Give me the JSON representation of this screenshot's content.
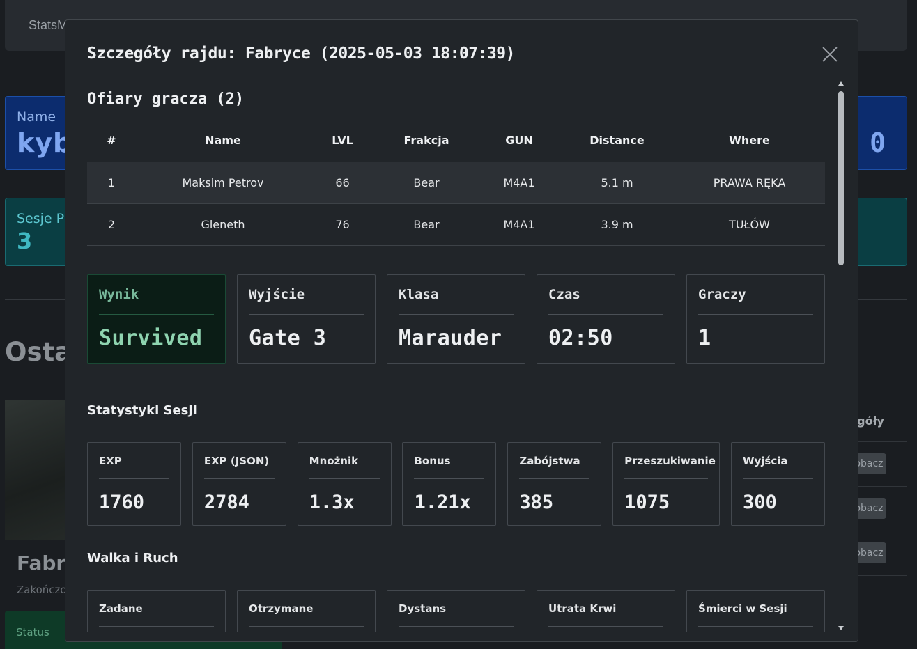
{
  "background": {
    "brand": "StatsM",
    "name_card": {
      "label": "Name",
      "value": "kyb",
      "value_right": "0"
    },
    "sessions_card": {
      "label": "Sesje P",
      "value": "3"
    },
    "recent_heading": "Osta",
    "raid_map": "Fabry",
    "raid_ended": "Zakończo",
    "status_label": "Status",
    "details_column": "zegóły",
    "view_button": "obacz"
  },
  "modal": {
    "title": "Szczegóły rajdu: Fabryce (2025-05-03 18:07:39)",
    "victims": {
      "heading": "Ofiary gracza (2)",
      "columns": [
        "#",
        "Name",
        "LVL",
        "Frakcja",
        "GUN",
        "Distance",
        "Where"
      ],
      "rows": [
        [
          "1",
          "Maksim Petrov",
          "66",
          "Bear",
          "M4A1",
          "5.1 m",
          "PRAWA RĘKA"
        ],
        [
          "2",
          "Gleneth",
          "76",
          "Bear",
          "M4A1",
          "3.9 m",
          "TUŁÓW"
        ]
      ]
    },
    "summary": [
      {
        "label": "Wynik",
        "value": "Survived"
      },
      {
        "label": "Wyjście",
        "value": "Gate 3"
      },
      {
        "label": "Klasa",
        "value": "Marauder"
      },
      {
        "label": "Czas",
        "value": "02:50"
      },
      {
        "label": "Graczy",
        "value": "1"
      }
    ],
    "session_stats": {
      "heading": "Statystyki Sesji",
      "items": [
        {
          "label": "EXP",
          "value": "1760"
        },
        {
          "label": "EXP (JSON)",
          "value": "2784"
        },
        {
          "label": "Mnożnik",
          "value": "1.3x"
        },
        {
          "label": "Bonus",
          "value": "1.21x"
        },
        {
          "label": "Zabójstwa",
          "value": "385"
        },
        {
          "label": "Przeszukiwanie",
          "value": "1075"
        },
        {
          "label": "Wyjścia",
          "value": "300"
        }
      ]
    },
    "combat": {
      "heading": "Walka i Ruch",
      "items": [
        {
          "label": "Zadane"
        },
        {
          "label": "Otrzymane"
        },
        {
          "label": "Dystans"
        },
        {
          "label": "Utrata Krwi"
        },
        {
          "label": "Śmierci w Sesji"
        }
      ]
    }
  },
  "colors": {
    "success_bg": "#0b1d16",
    "success_text": "#8fd4b0",
    "name_card_bg": "#0c2c6e",
    "sessions_card_bg": "#0a3e43"
  }
}
